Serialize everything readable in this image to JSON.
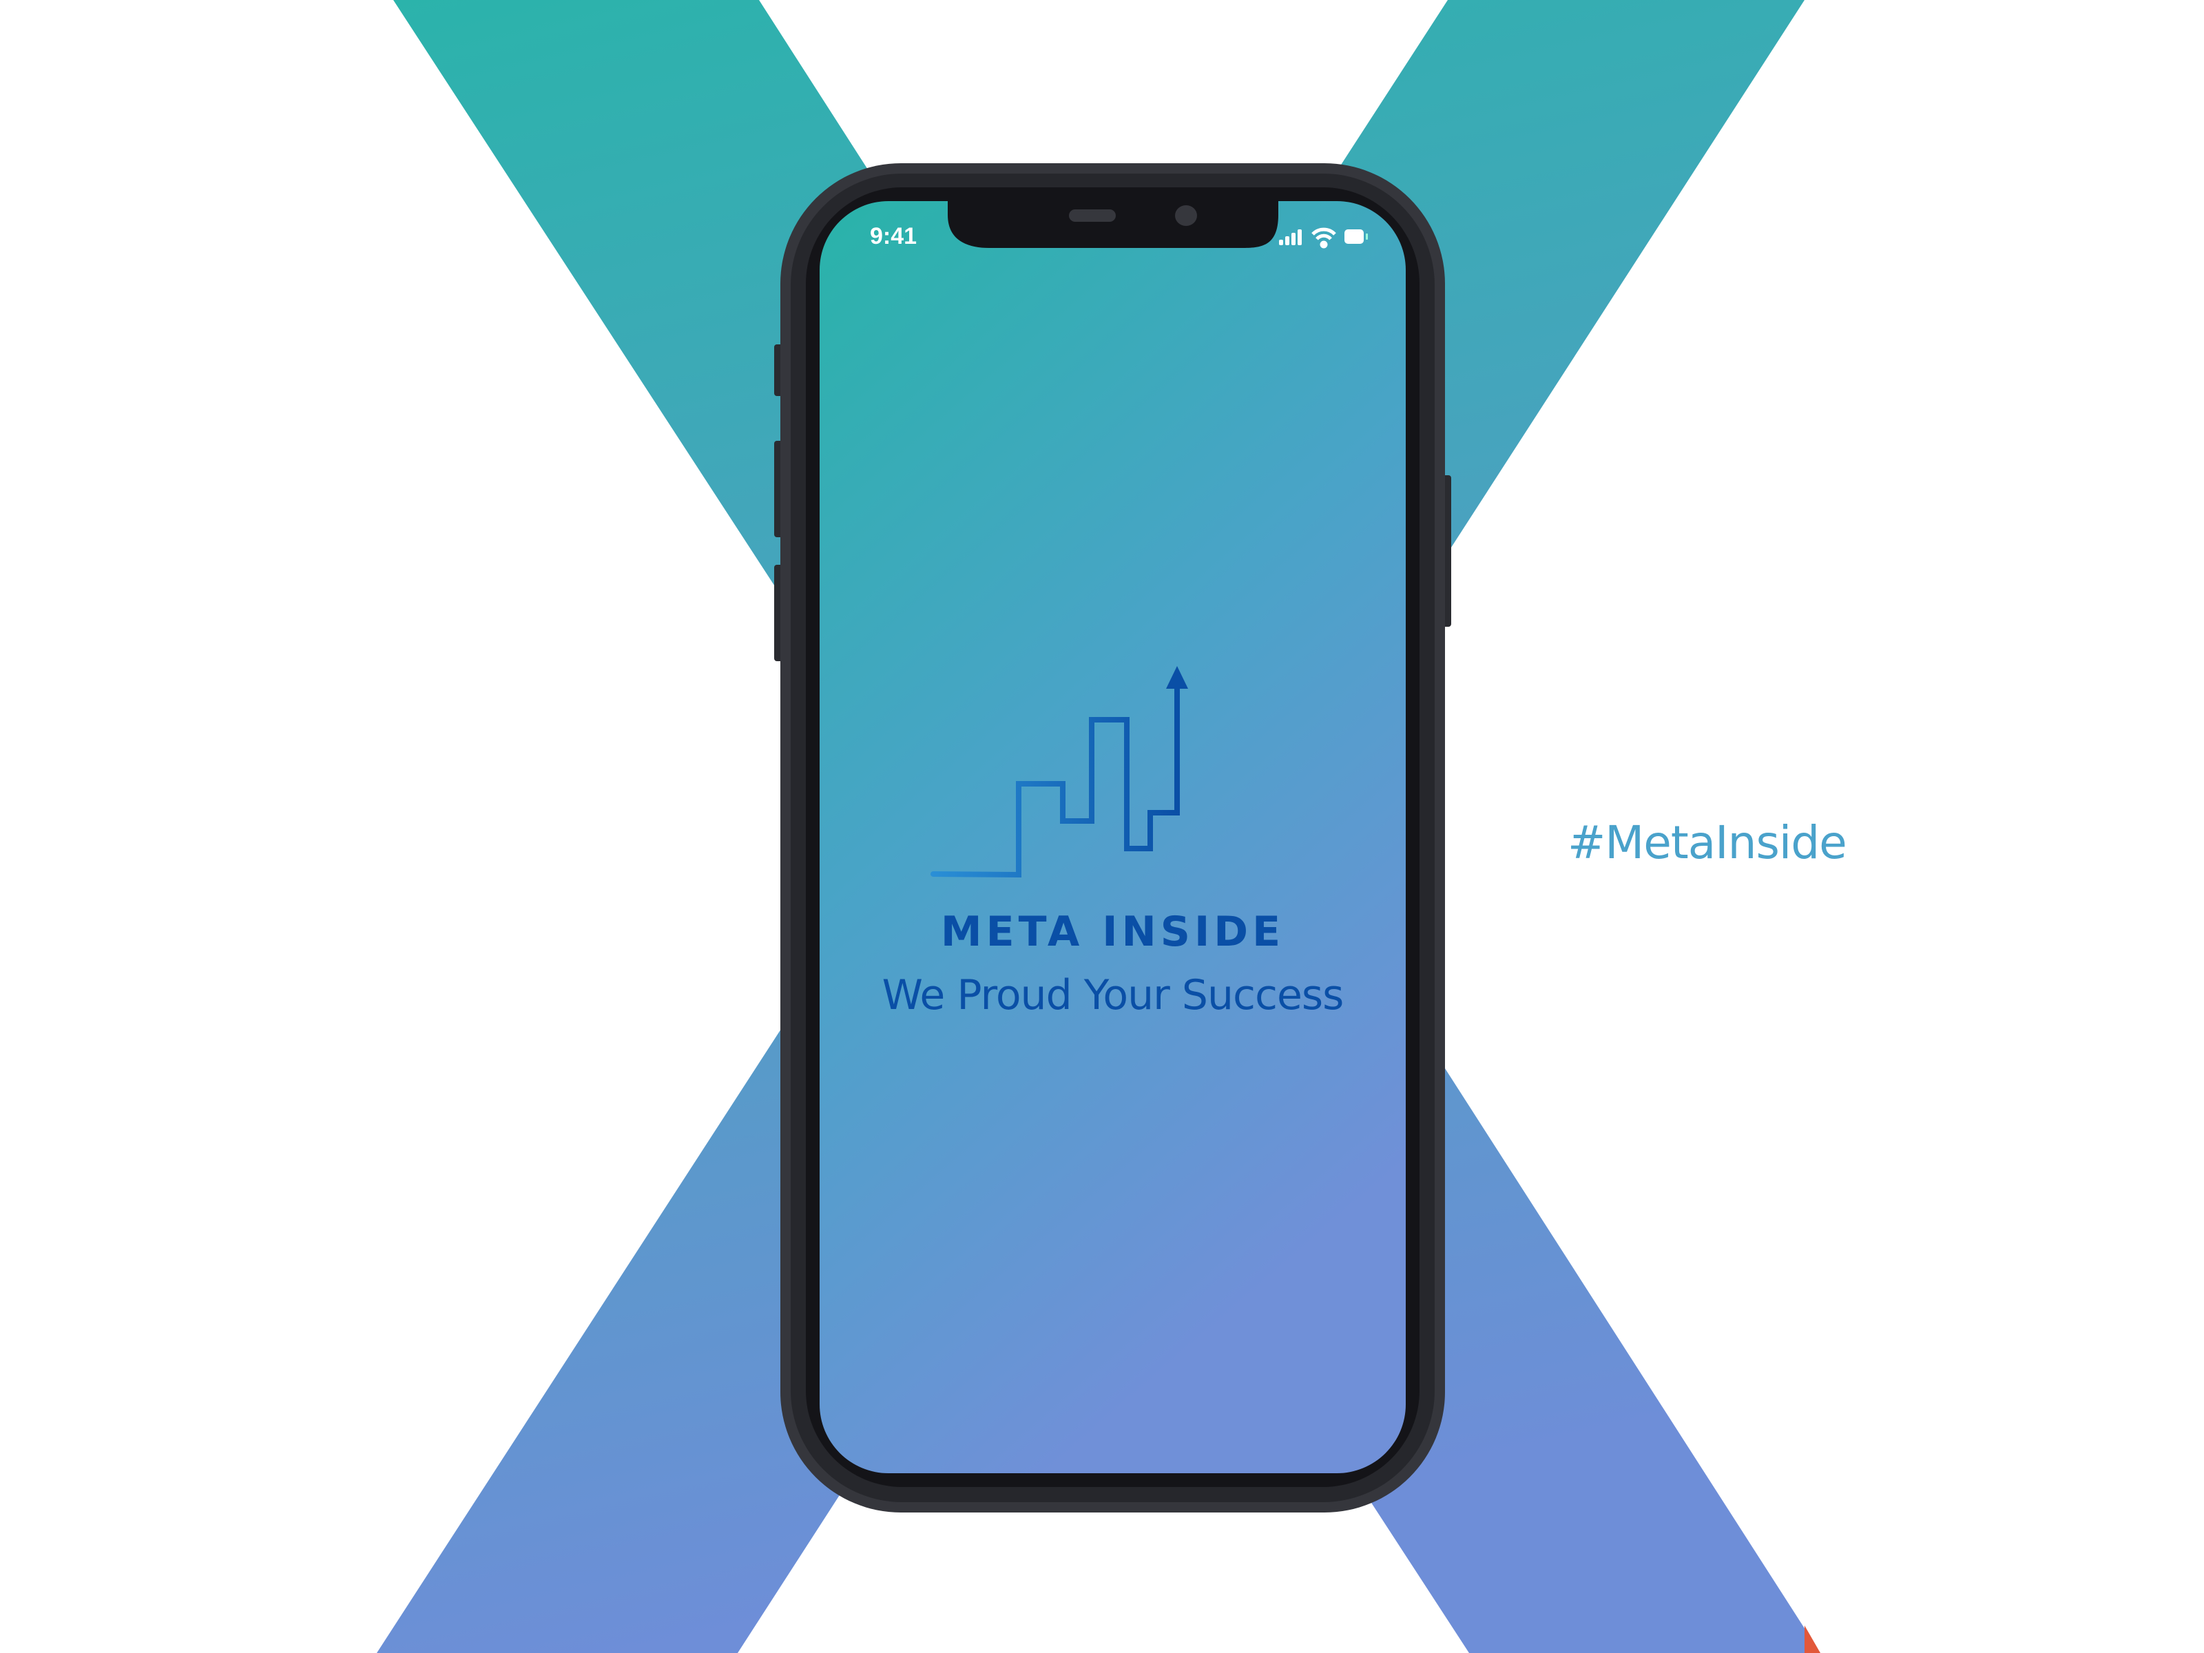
{
  "status_bar": {
    "time": "9:41",
    "icons": [
      "signal-icon",
      "wifi-icon",
      "battery-icon"
    ]
  },
  "app": {
    "brand_name": "META INSIDE",
    "tagline": "We Proud Your Success",
    "logo": "rising-steps-chart-arrow"
  },
  "hashtag": "#MetaInside",
  "colors": {
    "gradient_top": "#2bb3ab",
    "gradient_bottom": "#6e8ed8",
    "brand_blue": "#0a4fa6",
    "hashtag": "#4aa2cb",
    "phone_frame": "#2e2f35"
  }
}
